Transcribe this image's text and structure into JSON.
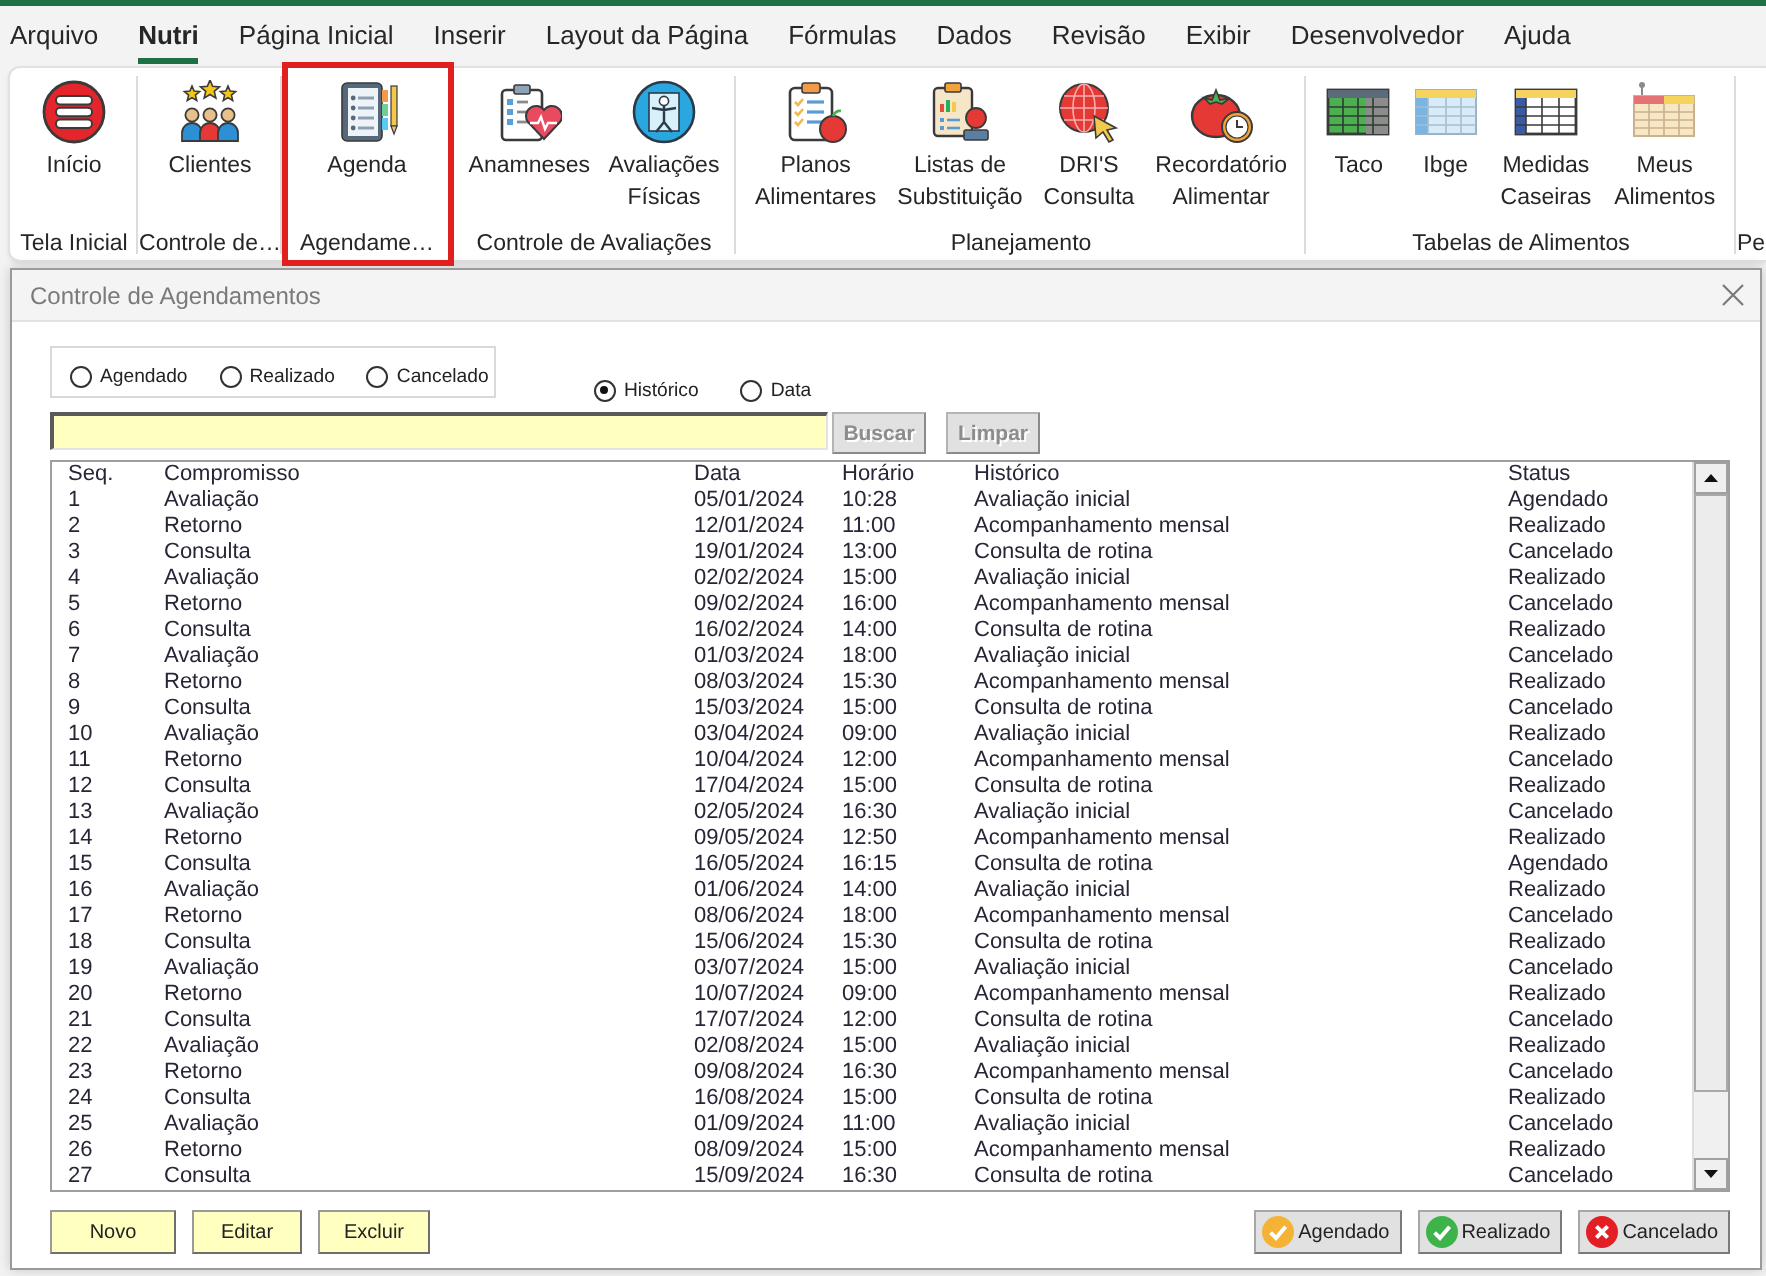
{
  "menu_tabs": [
    {
      "label": "Arquivo",
      "selected": false
    },
    {
      "label": "Nutri",
      "selected": true
    },
    {
      "label": "Página Inicial",
      "selected": false
    },
    {
      "label": "Inserir",
      "selected": false
    },
    {
      "label": "Layout da Página",
      "selected": false
    },
    {
      "label": "Fórmulas",
      "selected": false
    },
    {
      "label": "Dados",
      "selected": false
    },
    {
      "label": "Revisão",
      "selected": false
    },
    {
      "label": "Exibir",
      "selected": false
    },
    {
      "label": "Desenvolvedor",
      "selected": false
    },
    {
      "label": "Ajuda",
      "selected": false
    }
  ],
  "ribbon": {
    "groups": [
      {
        "label": "Tela Inicial",
        "highlighted": false,
        "buttons": [
          {
            "kind": "home",
            "lines": [
              "Início"
            ]
          }
        ]
      },
      {
        "label": "Controle de…",
        "highlighted": false,
        "buttons": [
          {
            "kind": "clients",
            "lines": [
              "Clientes"
            ]
          }
        ]
      },
      {
        "label": "Agendame…",
        "highlighted": true,
        "buttons": [
          {
            "kind": "agenda",
            "lines": [
              "Agenda"
            ]
          }
        ]
      },
      {
        "label": "Controle de Avaliações",
        "highlighted": false,
        "buttons": [
          {
            "kind": "anamnesis",
            "lines": [
              "Anamneses"
            ]
          },
          {
            "kind": "body",
            "lines": [
              "Avaliações",
              "Físicas"
            ]
          }
        ]
      },
      {
        "label": "Planejamento",
        "highlighted": false,
        "buttons": [
          {
            "kind": "plan",
            "lines": [
              "Planos",
              "Alimentares"
            ]
          },
          {
            "kind": "lists",
            "lines": [
              "Listas de",
              "Substituição"
            ]
          },
          {
            "kind": "globe",
            "lines": [
              "DRI'S",
              "Consulta"
            ]
          },
          {
            "kind": "tomato",
            "lines": [
              "Recordatório",
              "Alimentar"
            ]
          }
        ]
      },
      {
        "label": "Tabelas de Alimentos",
        "highlighted": false,
        "buttons": [
          {
            "kind": "greengrid",
            "lines": [
              "Taco"
            ]
          },
          {
            "kind": "bluegrid",
            "lines": [
              "Ibge"
            ]
          },
          {
            "kind": "framedgrid",
            "lines": [
              "Medidas",
              "Caseiras"
            ]
          },
          {
            "kind": "pinnedgrid",
            "lines": [
              "Meus",
              "Alimentos"
            ]
          }
        ]
      },
      {
        "label": "Pe",
        "highlighted": false
      }
    ]
  },
  "dialog": {
    "title": "Controle de Agendamentos",
    "status_filters": [
      {
        "label": "Agendado",
        "selected": false
      },
      {
        "label": "Realizado",
        "selected": false
      },
      {
        "label": "Cancelado",
        "selected": false
      }
    ],
    "search_modes": [
      {
        "label": "Histórico",
        "selected": true
      },
      {
        "label": "Data",
        "selected": false
      }
    ],
    "search_buttons": [
      {
        "label": "Buscar",
        "disabled": true
      },
      {
        "label": "Limpar",
        "disabled": true
      }
    ],
    "table": {
      "columns": [
        "Seq.",
        "Compromisso",
        "Data",
        "Horário",
        "Histórico",
        "Status"
      ],
      "rows": [
        [
          "1",
          "Avaliação",
          "05/01/2024",
          "10:28",
          "Avaliação inicial",
          "Agendado"
        ],
        [
          "2",
          "Retorno",
          "12/01/2024",
          "11:00",
          "Acompanhamento mensal",
          "Realizado"
        ],
        [
          "3",
          "Consulta",
          "19/01/2024",
          "13:00",
          "Consulta de rotina",
          "Cancelado"
        ],
        [
          "4",
          "Avaliação",
          "02/02/2024",
          "15:00",
          "Avaliação inicial",
          "Realizado"
        ],
        [
          "5",
          "Retorno",
          "09/02/2024",
          "16:00",
          "Acompanhamento mensal",
          "Cancelado"
        ],
        [
          "6",
          "Consulta",
          "16/02/2024",
          "14:00",
          "Consulta de rotina",
          "Realizado"
        ],
        [
          "7",
          "Avaliação",
          "01/03/2024",
          "18:00",
          "Avaliação inicial",
          "Cancelado"
        ],
        [
          "8",
          "Retorno",
          "08/03/2024",
          "15:30",
          "Acompanhamento mensal",
          "Realizado"
        ],
        [
          "9",
          "Consulta",
          "15/03/2024",
          "15:00",
          "Consulta de rotina",
          "Cancelado"
        ],
        [
          "10",
          "Avaliação",
          "03/04/2024",
          "09:00",
          "Avaliação inicial",
          "Realizado"
        ],
        [
          "11",
          "Retorno",
          "10/04/2024",
          "12:00",
          "Acompanhamento mensal",
          "Cancelado"
        ],
        [
          "12",
          "Consulta",
          "17/04/2024",
          "15:00",
          "Consulta de rotina",
          "Realizado"
        ],
        [
          "13",
          "Avaliação",
          "02/05/2024",
          "16:30",
          "Avaliação inicial",
          "Cancelado"
        ],
        [
          "14",
          "Retorno",
          "09/05/2024",
          "12:50",
          "Acompanhamento mensal",
          "Realizado"
        ],
        [
          "15",
          "Consulta",
          "16/05/2024",
          "16:15",
          "Consulta de rotina",
          "Agendado"
        ],
        [
          "16",
          "Avaliação",
          "01/06/2024",
          "14:00",
          "Avaliação inicial",
          "Realizado"
        ],
        [
          "17",
          "Retorno",
          "08/06/2024",
          "18:00",
          "Acompanhamento mensal",
          "Cancelado"
        ],
        [
          "18",
          "Consulta",
          "15/06/2024",
          "15:30",
          "Consulta de rotina",
          "Realizado"
        ],
        [
          "19",
          "Avaliação",
          "03/07/2024",
          "15:00",
          "Avaliação inicial",
          "Cancelado"
        ],
        [
          "20",
          "Retorno",
          "10/07/2024",
          "09:00",
          "Acompanhamento mensal",
          "Realizado"
        ],
        [
          "21",
          "Consulta",
          "17/07/2024",
          "12:00",
          "Consulta de rotina",
          "Cancelado"
        ],
        [
          "22",
          "Avaliação",
          "02/08/2024",
          "15:00",
          "Avaliação inicial",
          "Realizado"
        ],
        [
          "23",
          "Retorno",
          "09/08/2024",
          "16:30",
          "Acompanhamento mensal",
          "Cancelado"
        ],
        [
          "24",
          "Consulta",
          "16/08/2024",
          "15:00",
          "Consulta de rotina",
          "Realizado"
        ],
        [
          "25",
          "Avaliação",
          "01/09/2024",
          "11:00",
          "Avaliação inicial",
          "Cancelado"
        ],
        [
          "26",
          "Retorno",
          "08/09/2024",
          "15:00",
          "Acompanhamento mensal",
          "Realizado"
        ],
        [
          "27",
          "Consulta",
          "15/09/2024",
          "16:30",
          "Consulta de rotina",
          "Cancelado"
        ]
      ]
    },
    "record_buttons": [
      "Novo",
      "Editar",
      "Excluir"
    ],
    "status_buttons": [
      {
        "label": "Agendado",
        "kind": "check",
        "color": "#f5b335"
      },
      {
        "label": "Realizado",
        "kind": "check",
        "color": "#3db34a"
      },
      {
        "label": "Cancelado",
        "kind": "cross",
        "color": "#e31e24"
      }
    ]
  }
}
